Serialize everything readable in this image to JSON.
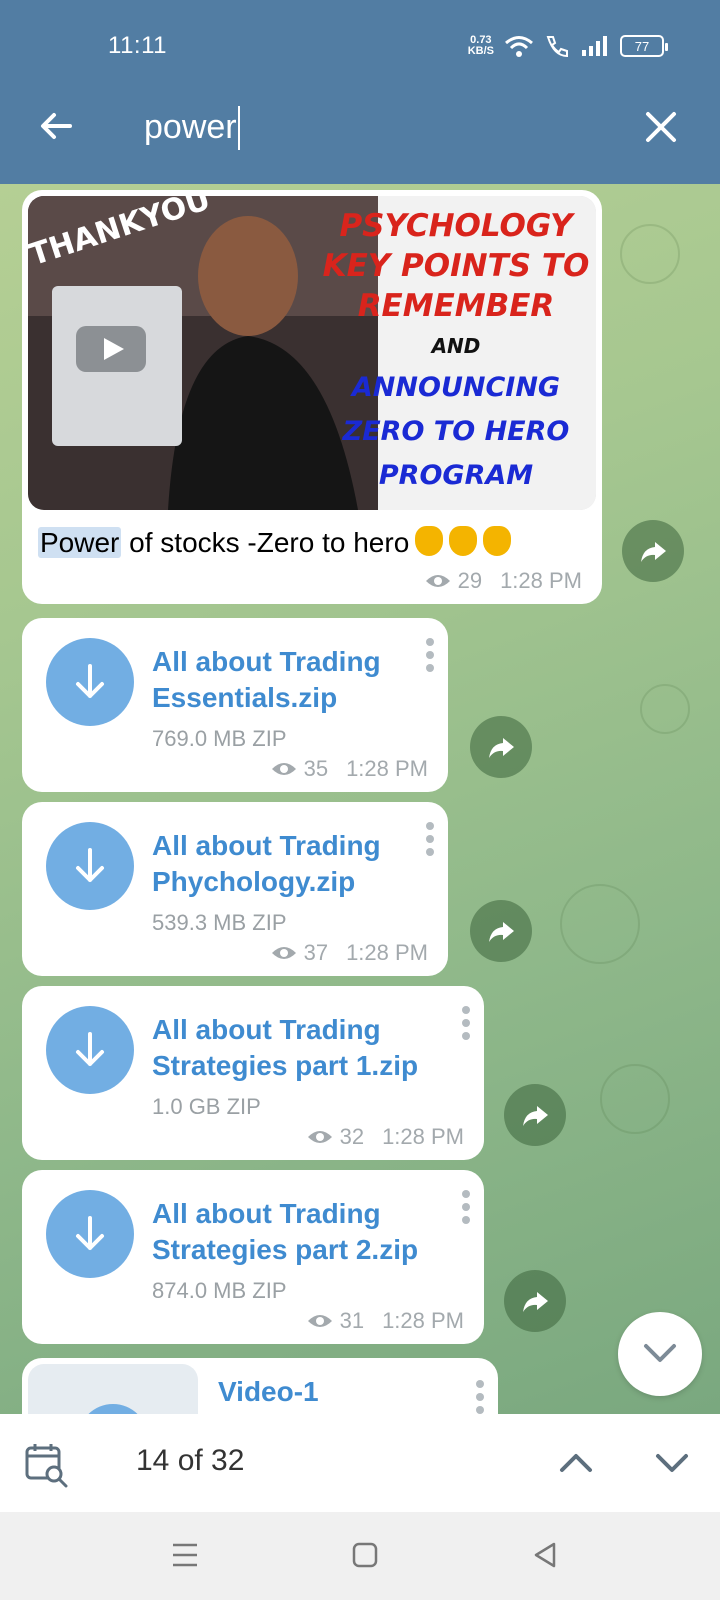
{
  "status_bar": {
    "time": "11:11",
    "net_speed_value": "0.73",
    "net_speed_unit": "KB/S",
    "battery": "77"
  },
  "search": {
    "query": "power"
  },
  "messages": {
    "photo_post": {
      "image_text": {
        "thankyou": "THANKYOU",
        "line1": "PSYCHOLOGY",
        "line2": "KEY POINTS TO",
        "line3": "REMEMBER",
        "line4": "AND",
        "line5": "ANNOUNCING",
        "line6": "ZERO TO HERO",
        "line7": "PROGRAM"
      },
      "caption_highlight": "Power",
      "caption_rest": " of stocks -Zero to hero",
      "views": "29",
      "time": "1:28 PM"
    },
    "files": [
      {
        "name_line1": "All about Trading",
        "name_line2": "Essentials.zip",
        "size": "769.0 MB ZIP",
        "views": "35",
        "time": "1:28 PM"
      },
      {
        "name_line1": "All about Trading",
        "name_line2": "Phychology.zip",
        "size": "539.3 MB ZIP",
        "views": "37",
        "time": "1:28 PM"
      },
      {
        "name_line1": "All about Trading",
        "name_line2": "Strategies part 1.zip",
        "size": "1.0 GB ZIP",
        "views": "32",
        "time": "1:28 PM"
      },
      {
        "name_line1": "All about Trading",
        "name_line2": "Strategies part 2.zip",
        "size": "874.0 MB ZIP",
        "views": "31",
        "time": "1:28 PM"
      }
    ],
    "video": {
      "title": "Video-1"
    }
  },
  "search_nav": {
    "counter": "14 of 32"
  },
  "colors": {
    "header": "#527da3",
    "link": "#3f8bd0",
    "download_circle": "#72aee3"
  },
  "icons": [
    "back-arrow-icon",
    "close-icon",
    "download-icon",
    "share-icon",
    "eye-icon",
    "menu-dots-icon",
    "calendar-search-icon",
    "chevron-up-icon",
    "chevron-down-icon"
  ]
}
